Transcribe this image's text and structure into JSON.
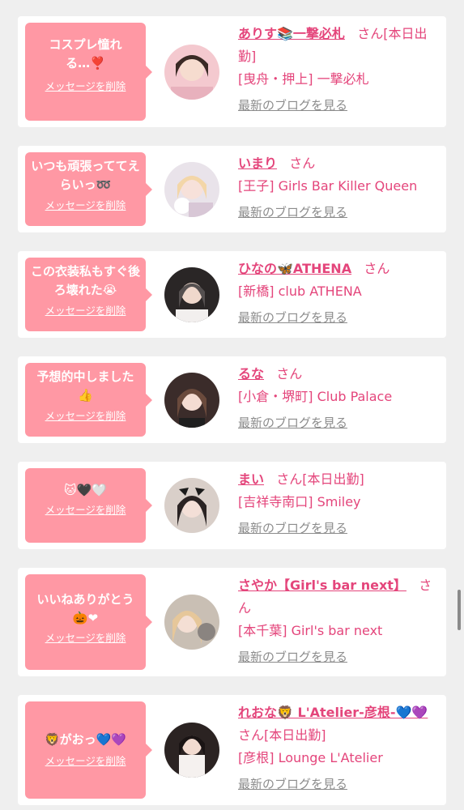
{
  "delete_label": "メッセージを削除",
  "blog_label": "最新のブログを見る",
  "san_label": "さん",
  "cards": [
    {
      "message": "コスプレ憧れる…❣️",
      "name": "ありす📚一撃必札",
      "san_suffix": "[本日出勤]",
      "shop": "[曳舟・押上] 一撃必札"
    },
    {
      "message": "いつも頑張っててえらいっ➿",
      "name": "いまり",
      "san_suffix": "",
      "shop": "[王子] Girls Bar Killer Queen"
    },
    {
      "message": "この衣装私もすぐ後ろ壊れた😭",
      "name": "ひなの🦋ATHENA",
      "san_suffix": "",
      "shop": "[新橋] club ATHENA"
    },
    {
      "message": "予想的中しました👍",
      "name": "るな",
      "san_suffix": "",
      "shop": "[小倉・堺町] Club Palace"
    },
    {
      "message": "🐱🖤🤍",
      "name": "まい",
      "san_suffix": "[本日出勤]",
      "shop": "[吉祥寺南口] Smiley"
    },
    {
      "message": "いいねありがとう🎃❤",
      "name": "さやか【Girl's bar next】",
      "san_suffix": "",
      "shop": "[本千葉] Girl's bar next"
    },
    {
      "message": "🦁がおっ💙💜",
      "name": "れおな🦁 L'Atelier-彦根-💙💜",
      "san_suffix": "[本日出勤]",
      "shop": "[彦根] Lounge L'Atelier"
    }
  ],
  "colors": {
    "background": "#efefef",
    "card": "#ffffff",
    "bubble": "#ff98a4",
    "accent": "#e4457b",
    "muted": "#8c8c8c"
  }
}
